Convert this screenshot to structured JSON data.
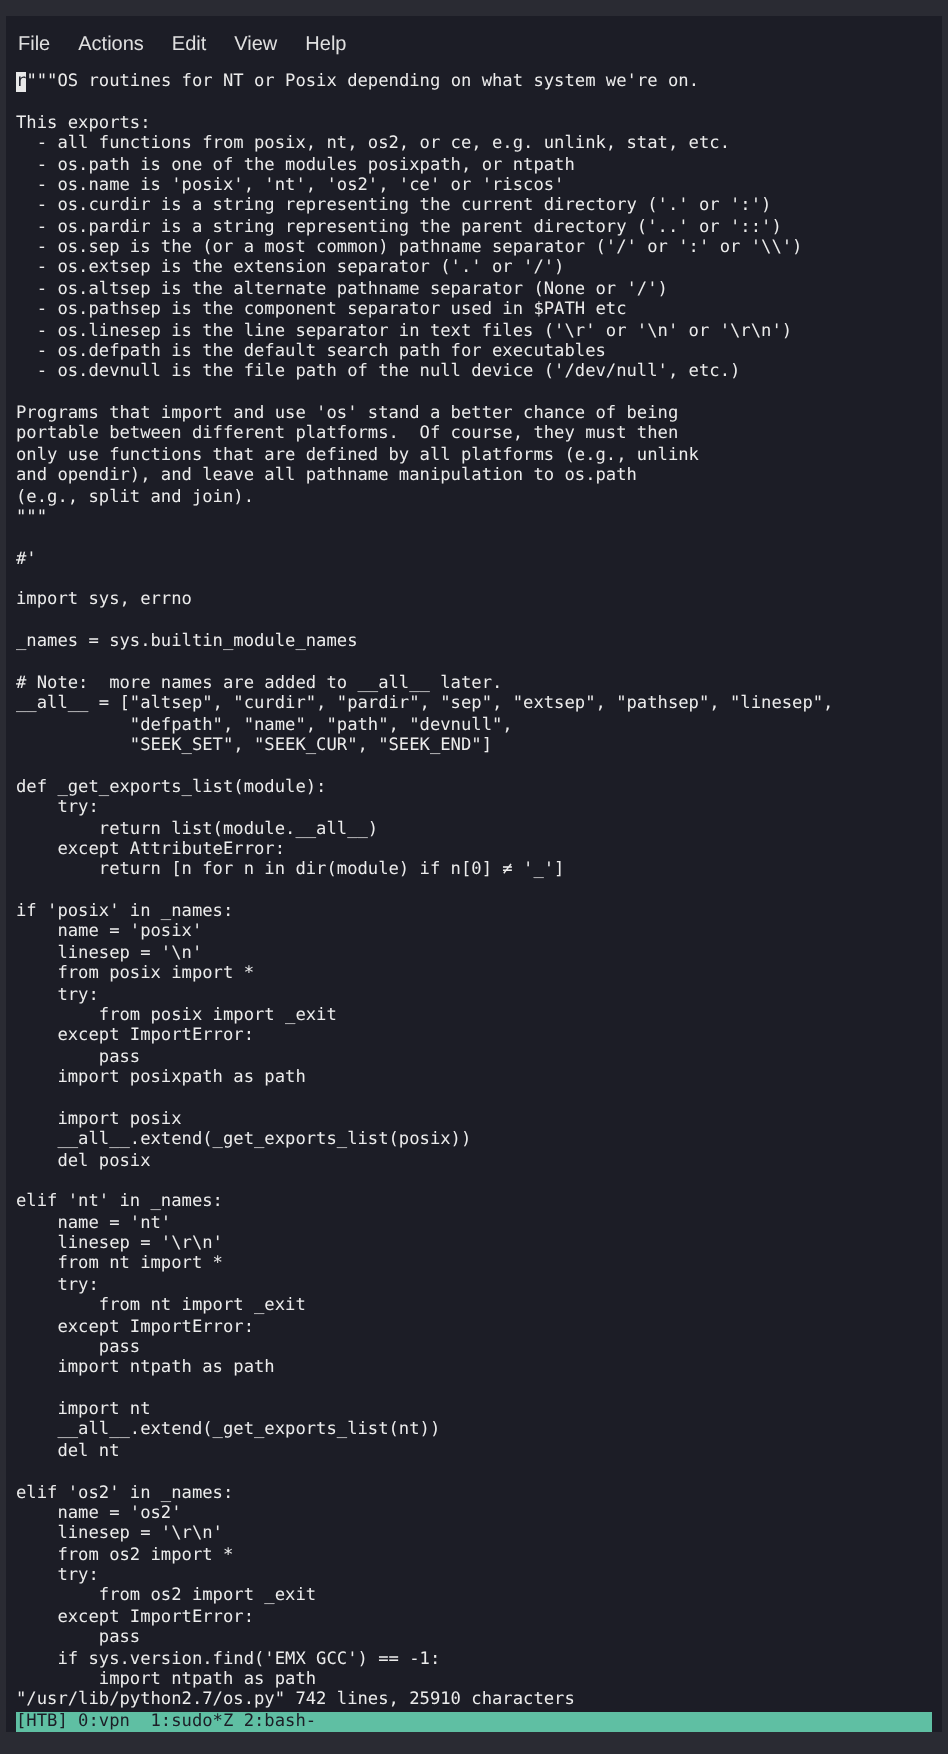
{
  "menu": [
    "File",
    "Actions",
    "Edit",
    "View",
    "Help"
  ],
  "editor": {
    "cursor": "r",
    "blocks": [
      [
        "\"\"\"OS routines for NT or Posix depending on what system we're on."
      ],
      [
        "This exports:",
        "  - all functions from posix, nt, os2, or ce, e.g. unlink, stat, etc.",
        "  - os.path is one of the modules posixpath, or ntpath",
        "  - os.name is 'posix', 'nt', 'os2', 'ce' or 'riscos'",
        "  - os.curdir is a string representing the current directory ('.' or ':')",
        "  - os.pardir is a string representing the parent directory ('..' or '::')",
        "  - os.sep is the (or a most common) pathname separator ('/' or ':' or '\\\\')",
        "  - os.extsep is the extension separator ('.' or '/')",
        "  - os.altsep is the alternate pathname separator (None or '/')",
        "  - os.pathsep is the component separator used in $PATH etc",
        "  - os.linesep is the line separator in text files ('\\r' or '\\n' or '\\r\\n')",
        "  - os.defpath is the default search path for executables",
        "  - os.devnull is the file path of the null device ('/dev/null', etc.)"
      ],
      [
        "Programs that import and use 'os' stand a better chance of being",
        "portable between different platforms.  Of course, they must then",
        "only use functions that are defined by all platforms (e.g., unlink",
        "and opendir), and leave all pathname manipulation to os.path",
        "(e.g., split and join).",
        "\"\"\""
      ],
      [
        "#'"
      ],
      [
        "import sys, errno"
      ],
      [
        "_names = sys.builtin_module_names"
      ],
      [
        "# Note:  more names are added to __all__ later.",
        "__all__ = [\"altsep\", \"curdir\", \"pardir\", \"sep\", \"extsep\", \"pathsep\", \"linesep\",",
        "           \"defpath\", \"name\", \"path\", \"devnull\",",
        "           \"SEEK_SET\", \"SEEK_CUR\", \"SEEK_END\"]"
      ],
      [
        "def _get_exports_list(module):",
        "    try:",
        "        return list(module.__all__)",
        "    except AttributeError:",
        "        return [n for n in dir(module) if n[0] ≠ '_']"
      ],
      [
        "if 'posix' in _names:",
        "    name = 'posix'",
        "    linesep = '\\n'",
        "    from posix import *",
        "    try:",
        "        from posix import _exit",
        "    except ImportError:",
        "        pass",
        "    import posixpath as path"
      ],
      [
        "    import posix",
        "    __all__.extend(_get_exports_list(posix))",
        "    del posix"
      ],
      [
        "elif 'nt' in _names:",
        "    name = 'nt'",
        "    linesep = '\\r\\n'",
        "    from nt import *",
        "    try:",
        "        from nt import _exit",
        "    except ImportError:",
        "        pass",
        "    import ntpath as path"
      ],
      [
        "    import nt",
        "    __all__.extend(_get_exports_list(nt))",
        "    del nt"
      ],
      [
        "elif 'os2' in _names:",
        "    name = 'os2'",
        "    linesep = '\\r\\n'",
        "    from os2 import *",
        "    try:",
        "        from os2 import _exit",
        "    except ImportError:",
        "        pass",
        "    if sys.version.find('EMX GCC') == -1:",
        "        import ntpath as path"
      ]
    ]
  },
  "message": "\"/usr/lib/python2.7/os.py\" 742 lines, 25910 characters",
  "tmux_bar": "[HTB] 0:vpn  1:sudo*Z 2:bash-"
}
